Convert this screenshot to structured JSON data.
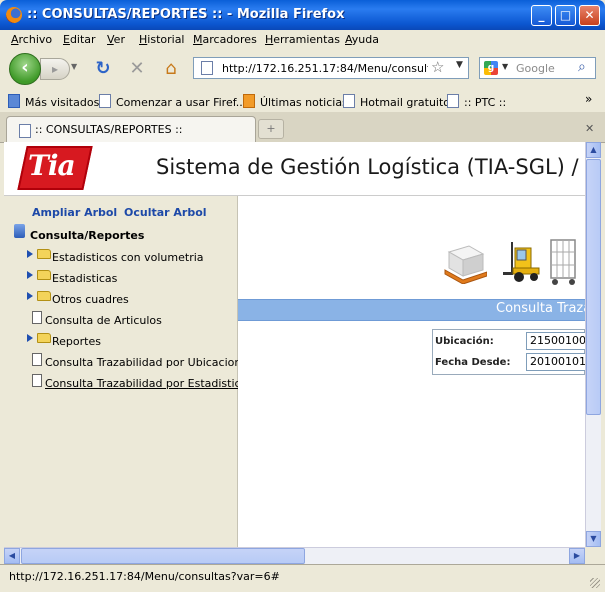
{
  "window": {
    "title": ":: CONSULTAS/REPORTES :: - Mozilla Firefox",
    "minimize": "_",
    "maximize": "□",
    "close": "✕"
  },
  "menu": [
    "Archivo",
    "Editar",
    "Ver",
    "Historial",
    "Marcadores",
    "Herramientas",
    "Ayuda"
  ],
  "nav": {
    "url": "http://172.16.251.17:84/Menu/consultas?var=6#",
    "search_placeholder": "Google"
  },
  "bookmarks": [
    "Más visitados",
    "Comenzar a usar Firef...",
    "Últimas noticias",
    "Hotmail gratuito",
    ":: PTC ::"
  ],
  "tabs": [
    ":: CONSULTAS/REPORTES ::"
  ],
  "page": {
    "logo_text": "Tia",
    "system_title": "Sistema de Gestión Logística (TIA-SGL) / CN",
    "tree_links": {
      "expand": "Ampliar Arbol",
      "collapse": "Ocultar Arbol"
    },
    "tree_root": "Consulta/Reportes",
    "tree_items": [
      "Estadisticos con volumetria",
      "Estadisticas",
      "Otros cuadres",
      "Consulta de Articulos",
      "Reportes",
      "Consulta Trazabilidad por Ubicacion",
      "Consulta Trazabilidad por Estadistico"
    ],
    "section_title": "Consulta Trazabilidad",
    "form": {
      "ubicacion_label": "Ubicación:",
      "ubicacion_value": "21500100",
      "fecha_label": "Fecha Desde:",
      "fecha_value": "20100101"
    }
  },
  "status": "http://172.16.251.17:84/Menu/consultas?var=6#"
}
